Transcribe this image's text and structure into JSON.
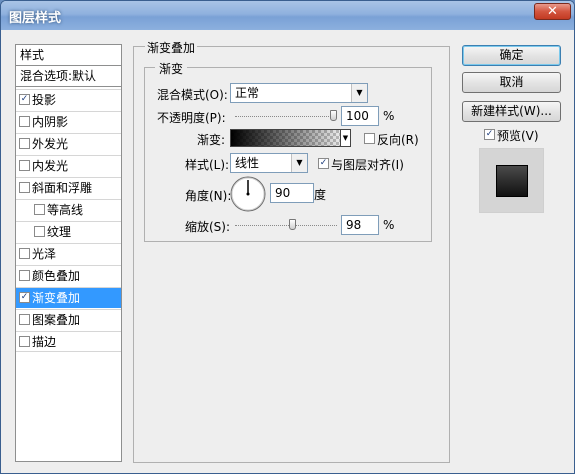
{
  "window": {
    "title": "图层样式",
    "close_label": "✕"
  },
  "sidebar": {
    "header": "样式",
    "blend_default": "混合选项:默认",
    "items": [
      {
        "label": "投影",
        "checked": true
      },
      {
        "label": "内阴影",
        "checked": false
      },
      {
        "label": "外发光",
        "checked": false
      },
      {
        "label": "内发光",
        "checked": false
      },
      {
        "label": "斜面和浮雕",
        "checked": false
      },
      {
        "label": "等高线",
        "checked": false,
        "indent": true
      },
      {
        "label": "纹理",
        "checked": false,
        "indent": true
      },
      {
        "label": "光泽",
        "checked": false
      },
      {
        "label": "颜色叠加",
        "checked": false
      },
      {
        "label": "渐变叠加",
        "checked": true,
        "selected": true
      },
      {
        "label": "图案叠加",
        "checked": false
      },
      {
        "label": "描边",
        "checked": false
      }
    ]
  },
  "panel": {
    "title": "渐变叠加",
    "subgroup": "渐变",
    "blend_mode": {
      "label": "混合模式(O):",
      "value": "正常"
    },
    "opacity": {
      "label": "不透明度(P):",
      "value": "100",
      "unit": "%",
      "level": 1.0
    },
    "gradient": {
      "label": "渐变:",
      "reverse_label": "反向(R)",
      "reverse_checked": false
    },
    "style": {
      "label": "样式(L):",
      "value": "线性",
      "align_label": "与图层对齐(I)",
      "align_checked": true
    },
    "angle": {
      "label": "角度(N):",
      "value": "90",
      "unit": "度"
    },
    "scale": {
      "label": "缩放(S):",
      "value": "98",
      "unit": "%",
      "level": 0.98
    }
  },
  "buttons": {
    "ok": "确定",
    "cancel": "取消",
    "new_style": "新建样式(W)...",
    "preview_label": "预览(V)",
    "preview_checked": true
  },
  "colors": {
    "selection": "#3399ff",
    "titlebar": "#8fb1de"
  }
}
